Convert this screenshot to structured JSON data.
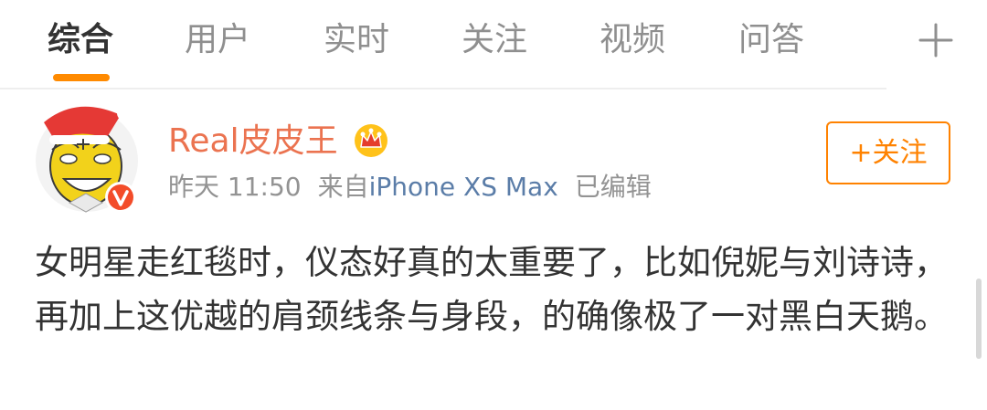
{
  "tabs": [
    {
      "label": "综合",
      "active": true
    },
    {
      "label": "用户",
      "active": false
    },
    {
      "label": "实时",
      "active": false
    },
    {
      "label": "关注",
      "active": false
    },
    {
      "label": "视频",
      "active": false
    },
    {
      "label": "问答",
      "active": false
    }
  ],
  "tab_add_icon": "plus-icon",
  "post": {
    "author": "Real皮皮王",
    "author_badge_icon": "crown-icon",
    "avatar_badge_icon": "verified-v-icon",
    "time": "昨天 11:50",
    "source_prefix": "来自",
    "source": "iPhone XS Max",
    "edited": "已编辑",
    "follow_label": "+关注",
    "text": "女明星走红毯时，仪态好真的太重要了，比如倪妮与刘诗诗，再加上这优越的肩颈线条与身段，的确像极了一对黑白天鹅。"
  },
  "colors": {
    "accent_orange": "#ff8200",
    "author_name": "#eb7350",
    "link_blue": "#5b7da8",
    "muted_text": "#939393"
  }
}
